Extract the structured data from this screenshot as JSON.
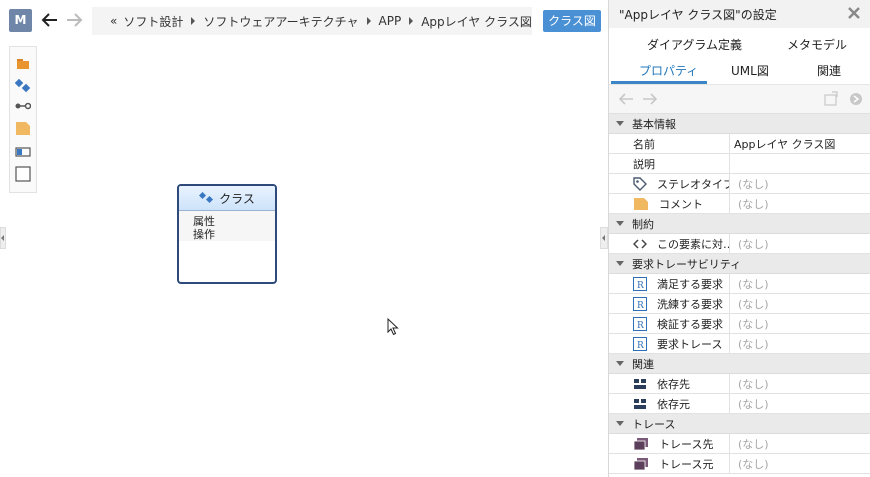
{
  "topbar": {
    "badge": "M",
    "breadcrumb": {
      "lead": "«",
      "items": [
        "ソフト設計",
        "ソフトウェアアーキテクチャ",
        "APP",
        "Appレイヤ クラス図"
      ]
    },
    "class_button": "クラス図"
  },
  "palette": {
    "items": [
      "package-icon",
      "class-icon",
      "association-icon",
      "note-icon",
      "frame-icon",
      "rectangle-icon"
    ]
  },
  "class_node": {
    "title": "クラス",
    "attribute": "属性",
    "operation": "操作"
  },
  "panel": {
    "title": "\"Appレイヤ クラス図\"の設定",
    "tabs_row1": [
      "ダイアグラム定義",
      "メタモデル"
    ],
    "tabs_row2": [
      "プロパティ",
      "UML図",
      "関連"
    ],
    "active_tab": "プロパティ",
    "groups": [
      {
        "label": "基本情報",
        "rows": [
          {
            "key": "名前",
            "value": "Appレイヤ クラス図",
            "icon": ""
          },
          {
            "key": "説明",
            "value": "",
            "icon": ""
          },
          {
            "key": "ステレオタイプ",
            "value": "(なし)",
            "icon": "tag-icon"
          },
          {
            "key": "コメント",
            "value": "(なし)",
            "icon": "comment-folder-icon"
          }
        ]
      },
      {
        "label": "制約",
        "rows": [
          {
            "key": "この要素に対…",
            "value": "(なし)",
            "icon": "code-icon"
          }
        ]
      },
      {
        "label": "要求トレーサビリティ",
        "rows": [
          {
            "key": "満足する要求",
            "value": "(なし)",
            "icon": "requirement-icon"
          },
          {
            "key": "洗練する要求",
            "value": "(なし)",
            "icon": "requirement-icon"
          },
          {
            "key": "検証する要求",
            "value": "(なし)",
            "icon": "requirement-icon"
          },
          {
            "key": "要求トレース",
            "value": "(なし)",
            "icon": "requirement-icon"
          }
        ]
      },
      {
        "label": "関連",
        "rows": [
          {
            "key": "依存先",
            "value": "(なし)",
            "icon": "dependency-icon"
          },
          {
            "key": "依存元",
            "value": "(なし)",
            "icon": "dependency-icon"
          }
        ]
      },
      {
        "label": "トレース",
        "rows": [
          {
            "key": "トレース先",
            "value": "(なし)",
            "icon": "trace-icon"
          },
          {
            "key": "トレース元",
            "value": "(なし)",
            "icon": "trace-icon"
          }
        ]
      }
    ]
  },
  "colors": {
    "accent": "#4a90d4",
    "node_border": "#2d4a7a",
    "badge": "#6f86a8"
  }
}
